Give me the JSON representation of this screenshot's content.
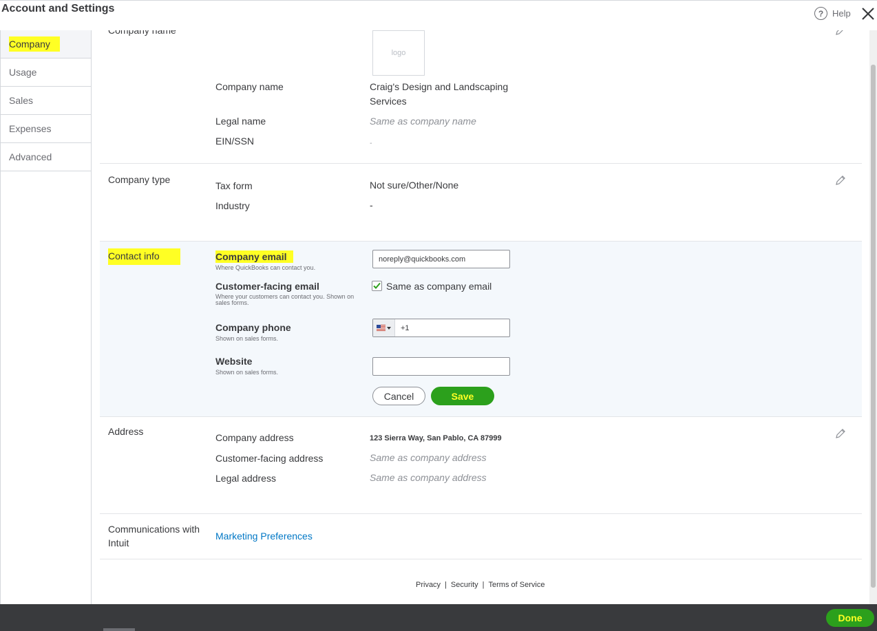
{
  "header": {
    "title": "Account and Settings",
    "help_label": "Help"
  },
  "sidebar": {
    "items": [
      {
        "label": "Company",
        "active": true
      },
      {
        "label": "Usage"
      },
      {
        "label": "Sales"
      },
      {
        "label": "Expenses"
      },
      {
        "label": "Advanced"
      }
    ]
  },
  "company_name_section": {
    "title_partial": "Company name",
    "logo_text": "logo",
    "company_name_label": "Company name",
    "company_name_line1": "Craig's Design and Landscaping",
    "company_name_line2": "Services",
    "legal_name_label": "Legal name",
    "legal_name_value": "Same as company name",
    "ein_label": "EIN/SSN",
    "ein_value": "-"
  },
  "company_type_section": {
    "title": "Company type",
    "tax_form_label": "Tax form",
    "tax_form_value": "Not sure/Other/None",
    "industry_label": "Industry",
    "industry_value": "-"
  },
  "contact_section": {
    "title": "Contact info",
    "company_email_label": "Company email",
    "company_email_hint": "Where QuickBooks can contact you.",
    "company_email_value": "noreply@quickbooks.com",
    "customer_email_label": "Customer-facing email",
    "customer_email_hint": "Where your customers can contact you. Shown on sales forms.",
    "same_as_label": "Same as company email",
    "same_as_checked": true,
    "phone_label": "Company phone",
    "phone_hint": "Shown on sales forms.",
    "phone_value": "+1",
    "website_label": "Website",
    "website_hint": "Shown on sales forms.",
    "website_value": "",
    "cancel_label": "Cancel",
    "save_label": "Save"
  },
  "address_section": {
    "title": "Address",
    "company_address_label": "Company address",
    "company_address_value": "123 Sierra Way, San Pablo, CA 87999",
    "customer_address_label": "Customer-facing address",
    "customer_address_value": "Same as company address",
    "legal_address_label": "Legal address",
    "legal_address_value": "Same as company address"
  },
  "communications_section": {
    "title_line1": "Communications with",
    "title_line2": "Intuit",
    "link_label": "Marketing Preferences"
  },
  "footer": {
    "privacy": "Privacy",
    "security": "Security",
    "terms": "Terms of Service",
    "separator": "|"
  },
  "bottom": {
    "done_label": "Done"
  },
  "colors": {
    "accent_green": "#2ca01c",
    "highlight": "#ffff24",
    "link_blue": "#0077c5",
    "bottom_bar": "#393a3d"
  }
}
